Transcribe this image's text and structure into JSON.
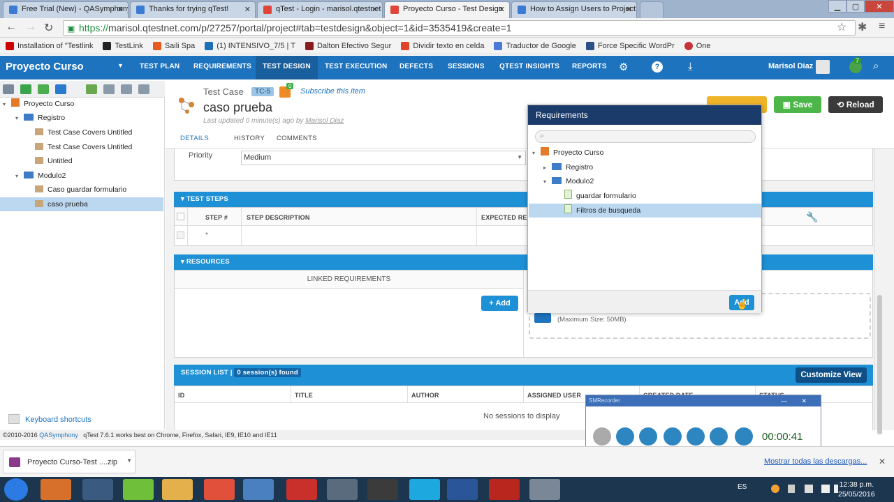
{
  "browser": {
    "tabs": [
      {
        "title": "Free Trial (New) - QASymphony",
        "close": "✕",
        "color": "#3b7bd4"
      },
      {
        "title": "Thanks for trying qTest!",
        "close": "✕",
        "color": "#3b7bd4"
      },
      {
        "title": "qTest - Login - marisol.qtestnet",
        "close": "✕",
        "color": "#e0453a"
      },
      {
        "title": "Proyecto Curso - Test Design",
        "close": "✕",
        "color": "#e0453a"
      },
      {
        "title": "How to Assign Users to Project",
        "close": "✕",
        "color": "#3b7bd4"
      }
    ],
    "url_scheme": "https://",
    "url_rest": "marisol.qtestnet.com/p/27257/portal/project#tab=testdesign&object=1&id=3535419&create=1",
    "bookmarks": [
      {
        "label": "Installation of \"Testlink",
        "color": "#cc0000"
      },
      {
        "label": "TestLink",
        "color": "#222222"
      },
      {
        "label": "Saili Spa",
        "color": "#e85a1e"
      },
      {
        "label": "(1) INTENSIVO_7/5 | T",
        "color": "#1f6fb5"
      },
      {
        "label": "Dalton Efectivo Segur",
        "color": "#8a1c1c"
      },
      {
        "label": "Dividir texto en celda",
        "color": "#e0452a"
      },
      {
        "label": "Traductor de Google",
        "color": "#4a7ad8"
      },
      {
        "label": "Force Specific WordPr",
        "color": "#2b4f8a"
      },
      {
        "label": "One",
        "color": "#c8333a"
      }
    ]
  },
  "app": {
    "title": "Proyecto Curso",
    "nav": [
      "TEST PLAN",
      "REQUIREMENTS",
      "TEST DESIGN",
      "TEST EXECUTION",
      "DEFECTS",
      "SESSIONS",
      "QTEST INSIGHTS",
      "REPORTS"
    ],
    "user": "Marisol Diaz",
    "notif_count": "7"
  },
  "tree": {
    "items": [
      {
        "label": "Proyecto Curso",
        "level": 0,
        "type": "project",
        "arrow": "▾"
      },
      {
        "label": "Registro",
        "level": 1,
        "type": "folder",
        "arrow": "▾"
      },
      {
        "label": "Test Case Covers Untitled",
        "level": 2,
        "type": "testcase",
        "arrow": ""
      },
      {
        "label": "Test Case Covers Untitled",
        "level": 2,
        "type": "testcase",
        "arrow": ""
      },
      {
        "label": "Untitled",
        "level": 2,
        "type": "testcase",
        "arrow": ""
      },
      {
        "label": "Modulo2",
        "level": 1,
        "type": "folder",
        "arrow": "▾"
      },
      {
        "label": "Caso guardar formulario",
        "level": 2,
        "type": "testcase",
        "arrow": ""
      },
      {
        "label": "caso prueba",
        "level": 2,
        "type": "testcase",
        "arrow": "",
        "selected": true
      }
    ],
    "keyboard_shortcuts": "Keyboard shortcuts"
  },
  "footer": {
    "copyright": "©2010-2016",
    "company": "QASymphony",
    "note": "qTest 7.6.1 works best on Chrome, Firefox, Safari, IE9, IE10 and IE11"
  },
  "testcase": {
    "type_label": "Test Case",
    "id_badge": "TC-5",
    "subscribe": "Subscribe this item",
    "rss_badge": "0",
    "title": "caso prueba",
    "updated_prefix": "Last updated 0 minute(s) ago by",
    "updated_by": "Marisol Diaz",
    "tabs": [
      "DETAILS",
      "HISTORY",
      "COMMENTS"
    ],
    "save_label": "Save",
    "reload_label": "Reload",
    "priority_label": "Priority",
    "priority_value": "Medium"
  },
  "test_steps": {
    "header": "TEST STEPS",
    "columns": [
      "STEP #",
      "STEP DESCRIPTION",
      "EXPECTED RE"
    ],
    "row_marker": "*"
  },
  "resources": {
    "header": "RESOURCES",
    "linked_requirements": "LINKED REQUIREMENTS",
    "add_label": "+ Add",
    "max_size": "(Maximum Size: 50MB)"
  },
  "sessions": {
    "header": "SESSION LIST |",
    "count_badge": "0 session(s) found",
    "customize": "Customize View",
    "columns": [
      "ID",
      "TITLE",
      "AUTHOR",
      "ASSIGNED USER",
      "CREATED DATE",
      "STATUS"
    ],
    "empty": "No sessions to display"
  },
  "requirements_popup": {
    "title": "Requirements",
    "tree": [
      {
        "label": "Proyecto Curso",
        "level": 0,
        "type": "project",
        "arrow": "▾"
      },
      {
        "label": "Registro",
        "level": 1,
        "type": "folder",
        "arrow": "▸"
      },
      {
        "label": "Modulo2",
        "level": 1,
        "type": "folder",
        "arrow": "▾"
      },
      {
        "label": "guardar formulario",
        "level": 2,
        "type": "req",
        "arrow": ""
      },
      {
        "label": "Filtros de busqueda",
        "level": 2,
        "type": "req",
        "arrow": "",
        "selected": true
      }
    ],
    "add_label": "Add"
  },
  "recorder": {
    "title": "SMRecorder",
    "min": "—",
    "close": "✕",
    "time": "00:00:41"
  },
  "download": {
    "file": "Proyecto Curso-Test ....zip",
    "show_all": "Mostrar todas las descargas...",
    "close": "✕"
  },
  "taskbar": {
    "lang": "ES",
    "time": "12:38 p.m.",
    "date": "25/05/2016"
  }
}
